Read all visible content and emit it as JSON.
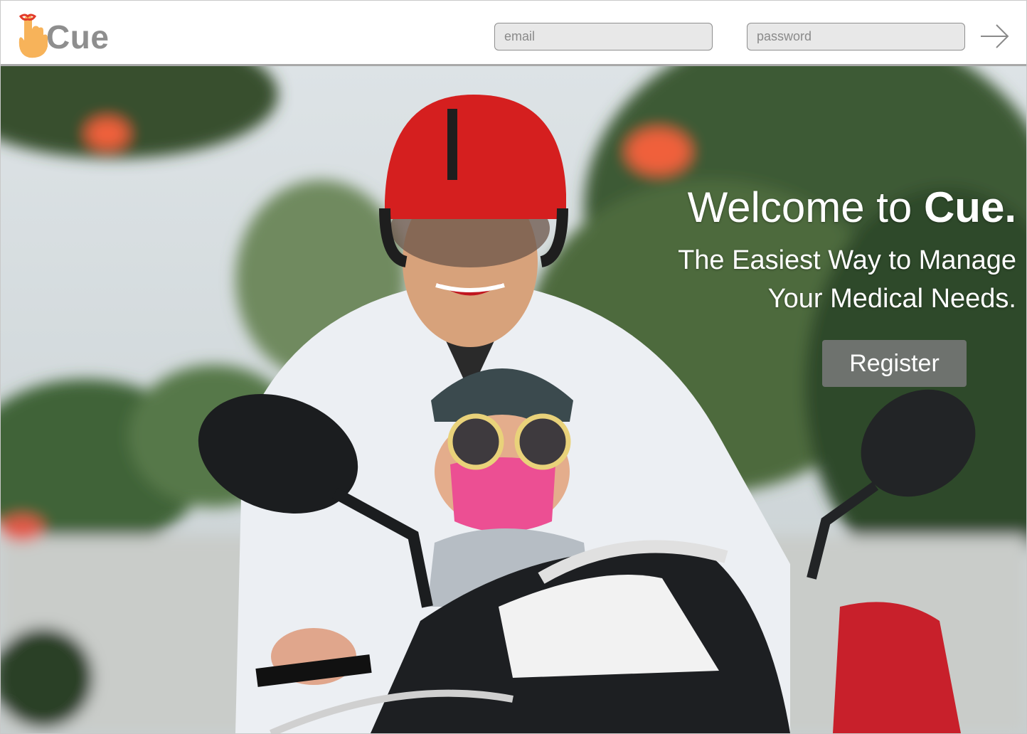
{
  "brand": {
    "name": "Cue",
    "accent": "#f59a3a",
    "ribbon": "#e23b2a",
    "text_color": "#8e8e8e"
  },
  "login": {
    "email_placeholder": "email",
    "password_placeholder": "password",
    "submit_icon": "arrow-right-icon"
  },
  "hero": {
    "welcome_prefix": "Welcome to ",
    "welcome_brand": "Cue.",
    "tagline_line1": "The Easiest Way to Manage",
    "tagline_line2": "Your Medical Needs.",
    "register_label": "Register"
  }
}
